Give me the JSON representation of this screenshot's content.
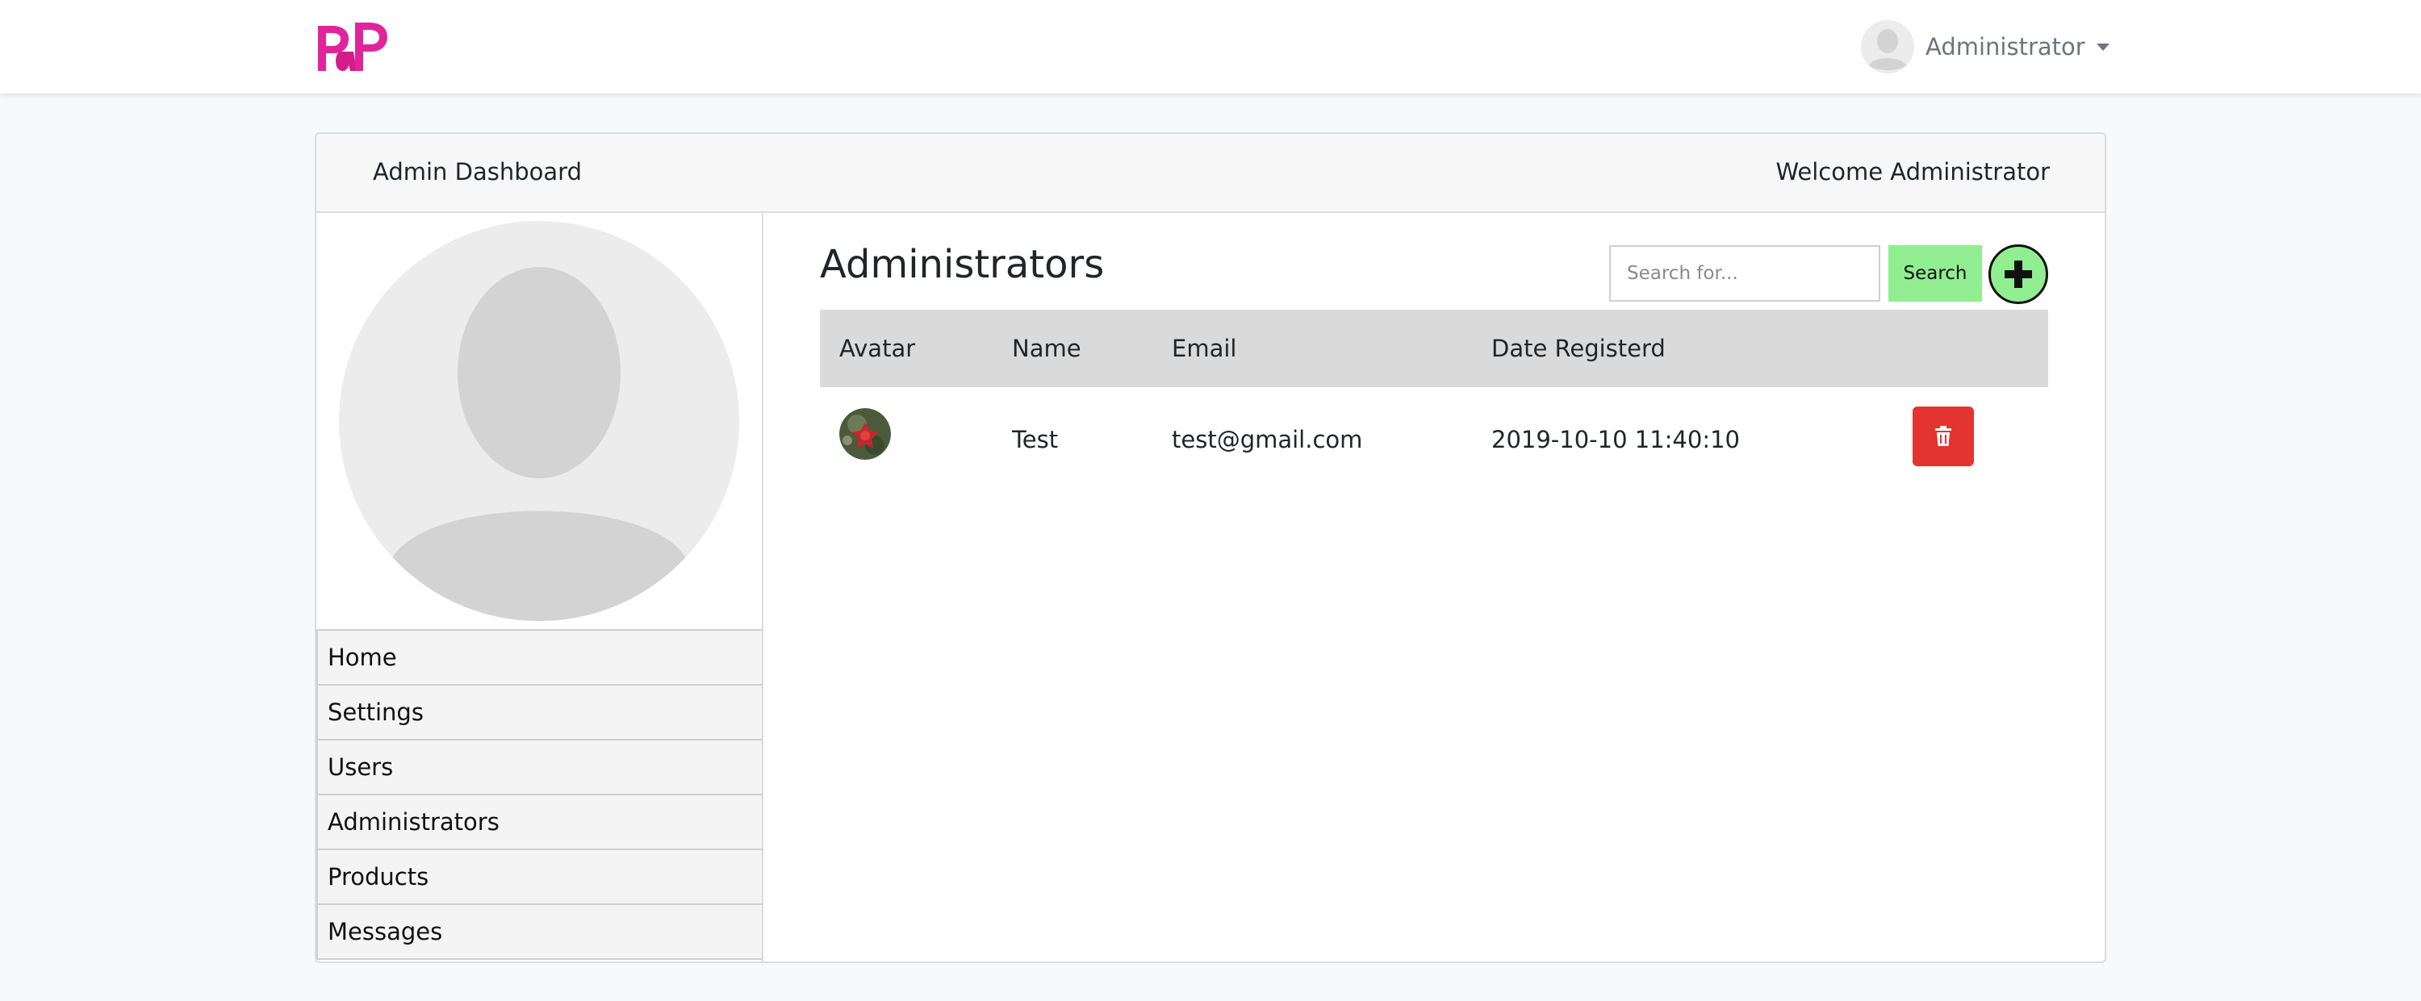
{
  "navbar": {
    "logo_text": "PaP",
    "user_name": "Administrator"
  },
  "card": {
    "header_title": "Admin Dashboard",
    "welcome_text": "Welcome Administrator"
  },
  "sidebar": {
    "items": [
      {
        "label": "Home"
      },
      {
        "label": "Settings"
      },
      {
        "label": "Users"
      },
      {
        "label": "Administrators"
      },
      {
        "label": "Products"
      },
      {
        "label": "Messages"
      }
    ]
  },
  "main": {
    "title": "Administrators",
    "search": {
      "placeholder": "Search for...",
      "button_label": "Search"
    },
    "add_icon": "plus-icon"
  },
  "table": {
    "columns": [
      "Avatar",
      "Name",
      "Email",
      "Date Registerd"
    ],
    "rows": [
      {
        "name": "Test",
        "email": "test@gmail.com",
        "date": "2019-10-10 11:40:10",
        "action_icon": "trash-icon"
      }
    ]
  },
  "colors": {
    "accent_green": "#90ee90",
    "danger_red": "#e3342f",
    "logo_pink": "#e0259b",
    "header_gray": "#dadada"
  }
}
